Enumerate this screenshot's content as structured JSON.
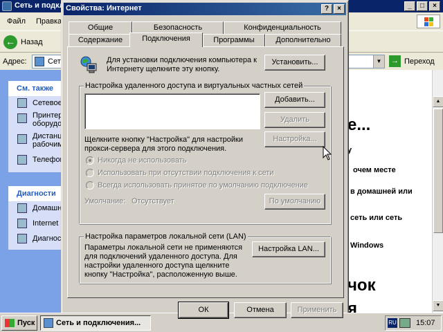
{
  "background_window": {
    "title": "Сеть и подкл",
    "menu": [
      "Файл",
      "Правка"
    ],
    "toolbar": {
      "back_label": "Назад"
    },
    "address": {
      "label": "Адрес:",
      "value": "Сет",
      "go_label": "Переход"
    },
    "left_pane": {
      "see_also": {
        "header": "См. также",
        "items": [
          "Сетевое",
          "Принтер оборудо",
          "Дистанц рабочим",
          "Телефон"
        ]
      },
      "troubleshoot": {
        "header": "Диагности",
        "items": [
          "Домашн",
          "Internet",
          "Диагнос"
        ]
      }
    },
    "right_text": [
      "е...",
      "у",
      "очем месте",
      "в домашней или",
      "сеть или сеть",
      "Windows",
      "чок",
      "я"
    ]
  },
  "dialog": {
    "title": "Свойства: Интернет",
    "help_label": "?",
    "close_label": "×",
    "tabs_row1": [
      "Общие",
      "Безопасность",
      "Конфиденциальность"
    ],
    "tabs_row2": [
      "Содержание",
      "Подключения",
      "Программы",
      "Дополнительно"
    ],
    "setup": {
      "text": "Для установки подключения компьютера к Интернету щелкните эту кнопку.",
      "button": "Установить..."
    },
    "dialup": {
      "group_label": "Настройка удаленного доступа и виртуальных частных сетей",
      "add_button": "Добавить...",
      "remove_button": "Удалить",
      "settings_button": "Настройка...",
      "hint": "Щелкните кнопку \"Настройка\" для настройки прокси-сервера для этого подключения.",
      "radio_never": "Никогда не использовать",
      "radio_absent": "Использовать при отсутствии подключения к сети",
      "radio_always": "Всегда использовать принятое по умолчанию подключение",
      "default_label": "Умолчание:",
      "default_value": "Отсутствует",
      "default_button": "По умолчанию"
    },
    "lan": {
      "group_label": "Настройка параметров локальной сети (LAN)",
      "text": "Параметры локальной сети не применяются для подключений удаленного доступа. Для настройки удаленного доступа щелкните кнопку \"Настройка\", расположенную выше.",
      "button": "Настройка LAN..."
    },
    "footer": {
      "ok": "ОК",
      "cancel": "Отмена",
      "apply": "Применить"
    }
  },
  "taskbar": {
    "start_label": "Пуск",
    "task_label": "Сеть и подключения...",
    "lang": "RU",
    "time": "15:07"
  }
}
